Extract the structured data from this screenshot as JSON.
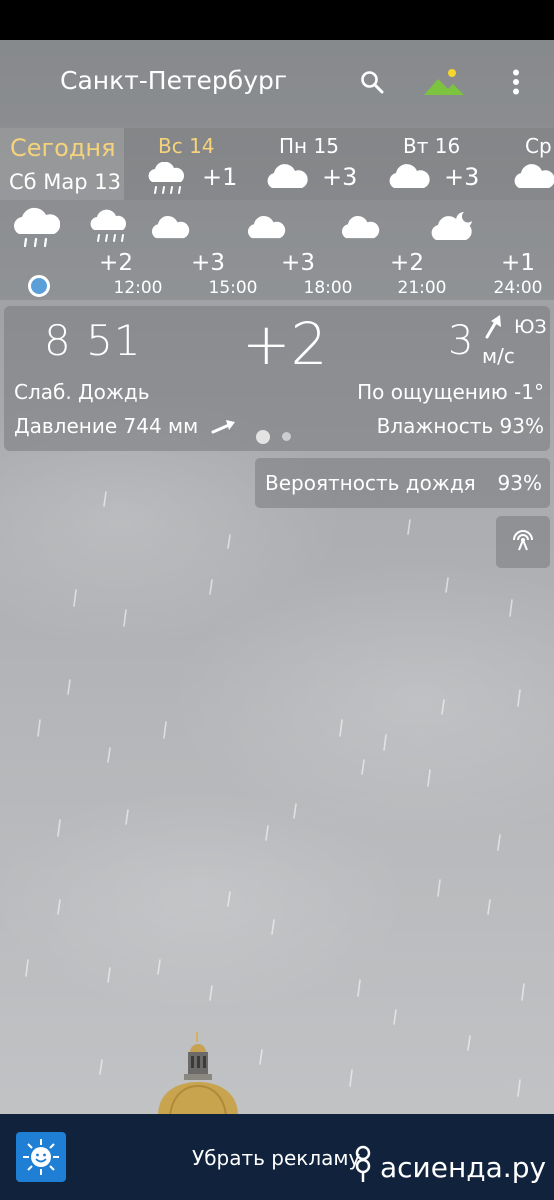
{
  "header": {
    "city": "Санкт-Петербург",
    "icons": [
      "search-icon",
      "landscape-icon",
      "more-vert-icon"
    ]
  },
  "days": {
    "today": {
      "label": "Сегодня",
      "date": "Сб Мар 13"
    },
    "list": [
      {
        "name": "Вс 14",
        "temp": "+1",
        "icon": "cloud-rain-icon"
      },
      {
        "name": "Пн 15",
        "temp": "+3",
        "icon": "cloud-icon"
      },
      {
        "name": "Вт 16",
        "temp": "+3",
        "icon": "cloud-icon"
      },
      {
        "name": "Ср",
        "temp": "",
        "icon": "cloud-icon"
      }
    ]
  },
  "hourly": [
    {
      "time": "12:00",
      "temp": "+2",
      "icon": "cloud-rain-icon"
    },
    {
      "time": "15:00",
      "temp": "+3",
      "icon": "cloud-icon"
    },
    {
      "time": "18:00",
      "temp": "+3",
      "icon": "cloud-icon"
    },
    {
      "time": "21:00",
      "temp": "+2",
      "icon": "cloud-icon"
    },
    {
      "time": "24:00",
      "temp": "+1",
      "icon": "cloud-moon-icon"
    }
  ],
  "current": {
    "time": "8 51",
    "temp": "+2",
    "wind_speed": "3",
    "wind_dir": "ЮЗ",
    "wind_unit": "м/с",
    "condition": "Слаб. Дождь",
    "feels_like": "По ощущению -1°",
    "pressure": "Давление 744 мм",
    "humidity": "Влажность 93%"
  },
  "rain_probability": {
    "label": "Вероятность дождя",
    "value": "93%"
  },
  "ad": {
    "text": "Убрать рекламу",
    "watermark": "асиенда.ру"
  },
  "colors": {
    "today_accent": "#f4d37a",
    "ad_bar": "#10223c",
    "ad_logo": "#1f7fd4"
  }
}
